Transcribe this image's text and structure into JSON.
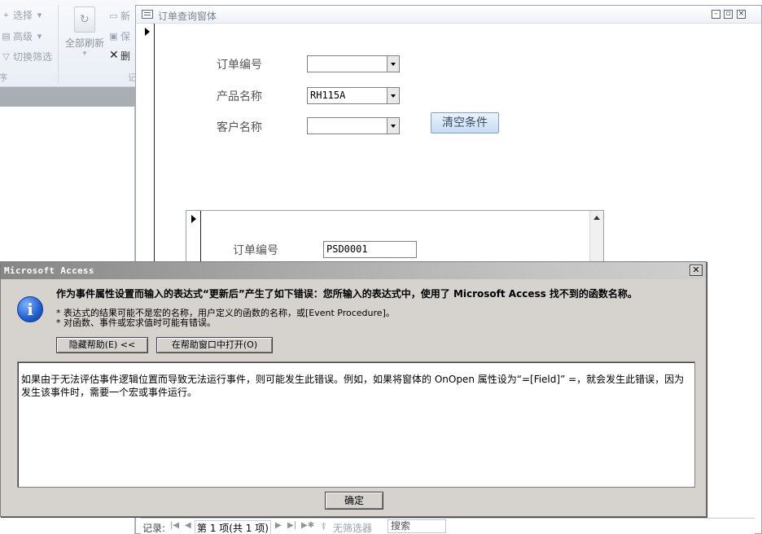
{
  "ribbon": {
    "select_label": "选择",
    "advanced_label": "高级",
    "toggle_filter_label": "切换筛选",
    "refresh_all_label": "全部刷新",
    "new_label": "新",
    "save_label": "保",
    "delete_label": "删",
    "group_label_left": "序",
    "group_label_right": "记"
  },
  "form": {
    "title": "订单查询窗体",
    "fields": {
      "order_no_label": "订单编号",
      "order_no_value": "",
      "product_label": "产品名称",
      "product_value": "RH115A",
      "customer_label": "客户名称",
      "customer_value": ""
    },
    "clear_button": "清空条件",
    "subform": {
      "order_no_label": "订单编号",
      "order_no_value": "PSD0001"
    },
    "record_nav": {
      "label": "记录:",
      "position": "第 1 项(共 1 项)",
      "filter_status": "无筛选器",
      "search_label": "搜索"
    }
  },
  "dialog": {
    "title": "Microsoft Access",
    "close_glyph": "✕",
    "message": "作为事件属性设置而输入的表达式“更新后”产生了如下错误：您所输入的表达式中，使用了 Microsoft Access 找不到的函数名称。",
    "bullet1": "* 表达式的结果可能不是宏的名称，用户定义的函数的名称，或[Event Procedure]。",
    "bullet2": "* 对函数、事件或宏求值时可能有错误。",
    "hide_help_button": "隐藏帮助(E) <<",
    "open_help_button": "在帮助窗口中打开(O)",
    "help_text": "如果由于无法评估事件逻辑位置而导致无法运行事件，则可能发生此错误。例如，如果将窗体的 OnOpen 属性设为“=[Field]” =，就会发生此错误，因为发生该事件时，需要一个宏或事件运行。",
    "ok_button": "确定"
  }
}
